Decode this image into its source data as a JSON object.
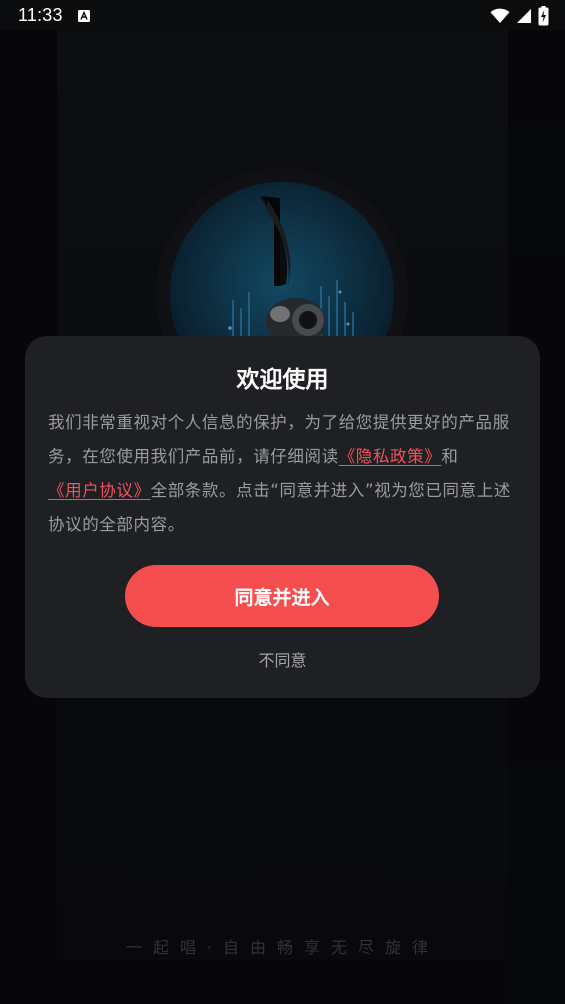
{
  "status_bar": {
    "time": "11:33"
  },
  "splash": {
    "slogan": "一起唱·自由畅享无尽旋律"
  },
  "dialog": {
    "title": "欢迎使用",
    "body_part1": "我们非常重视对个人信息的保护，为了给您提供更好的产品服务，在您使用我们产品前，请仔细阅读",
    "privacy_link": "《隐私政策》",
    "body_and": "和",
    "agreement_link": "《用户协议》",
    "body_part2": "全部条款。点击“同意并进入”视为您已同意上述协议的全部内容。",
    "agree_button": "同意并进入",
    "disagree_button": "不同意"
  },
  "colors": {
    "accent": "#f54e4f",
    "link": "#f0545a",
    "dialog_bg": "#1f2024",
    "page_bg": "#0b0c0e"
  },
  "icons": {
    "status_app": "app-notification-icon",
    "wifi": "wifi-icon",
    "signal": "signal-icon",
    "battery": "battery-charging-icon",
    "logo": "music-note-logo-icon"
  }
}
